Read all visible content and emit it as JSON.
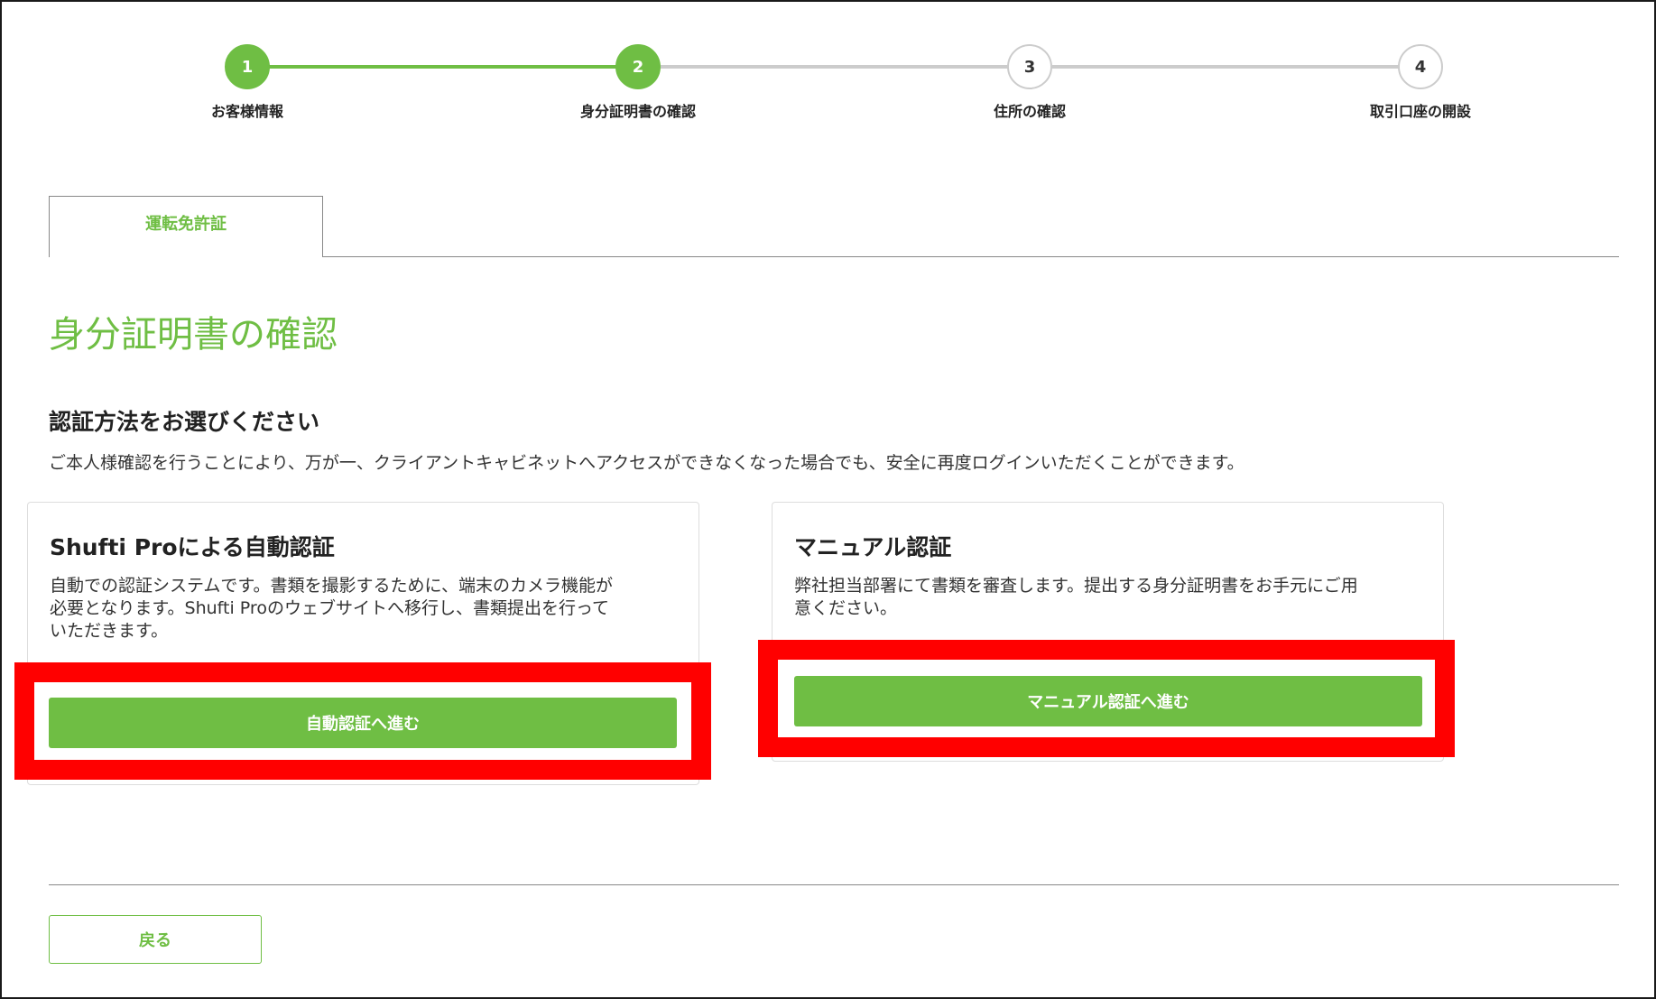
{
  "stepper": {
    "steps": [
      {
        "number": "1",
        "label": "お客様情報",
        "state": "done"
      },
      {
        "number": "2",
        "label": "身分証明書の確認",
        "state": "done"
      },
      {
        "number": "3",
        "label": "住所の確認",
        "state": "todo"
      },
      {
        "number": "4",
        "label": "取引口座の開設",
        "state": "todo"
      }
    ]
  },
  "tabs": [
    {
      "label": "運転免許証",
      "active": true
    }
  ],
  "page": {
    "title": "身分証明書の確認",
    "section_title": "認証方法をお選びください",
    "section_desc": "ご本人様確認を行うことにより、万が一、クライアントキャビネットへアクセスができなくなった場合でも、安全に再度ログインいただくことができます。"
  },
  "cards": {
    "auto": {
      "title": "Shufti Proによる自動認証",
      "desc_lines": [
        "自動での認証システムです。書類を撮影するために、端末のカメラ機能が",
        "必要となります。Shufti Proのウェブサイトへ移行し、書類提出を行って",
        "いただきます。"
      ],
      "button_label": "自動認証へ進む"
    },
    "manual": {
      "title": "マニュアル認証",
      "desc_lines": [
        "弊社担当部署にて書類を審査します。提出する身分証明書をお手元にご用",
        "意ください。"
      ],
      "button_label": "マニュアル認証へ進む"
    }
  },
  "footer": {
    "back_label": "戻る"
  },
  "colors": {
    "accent": "#6fbe44",
    "highlight": "#ff0000",
    "inactive": "#cccccc"
  }
}
